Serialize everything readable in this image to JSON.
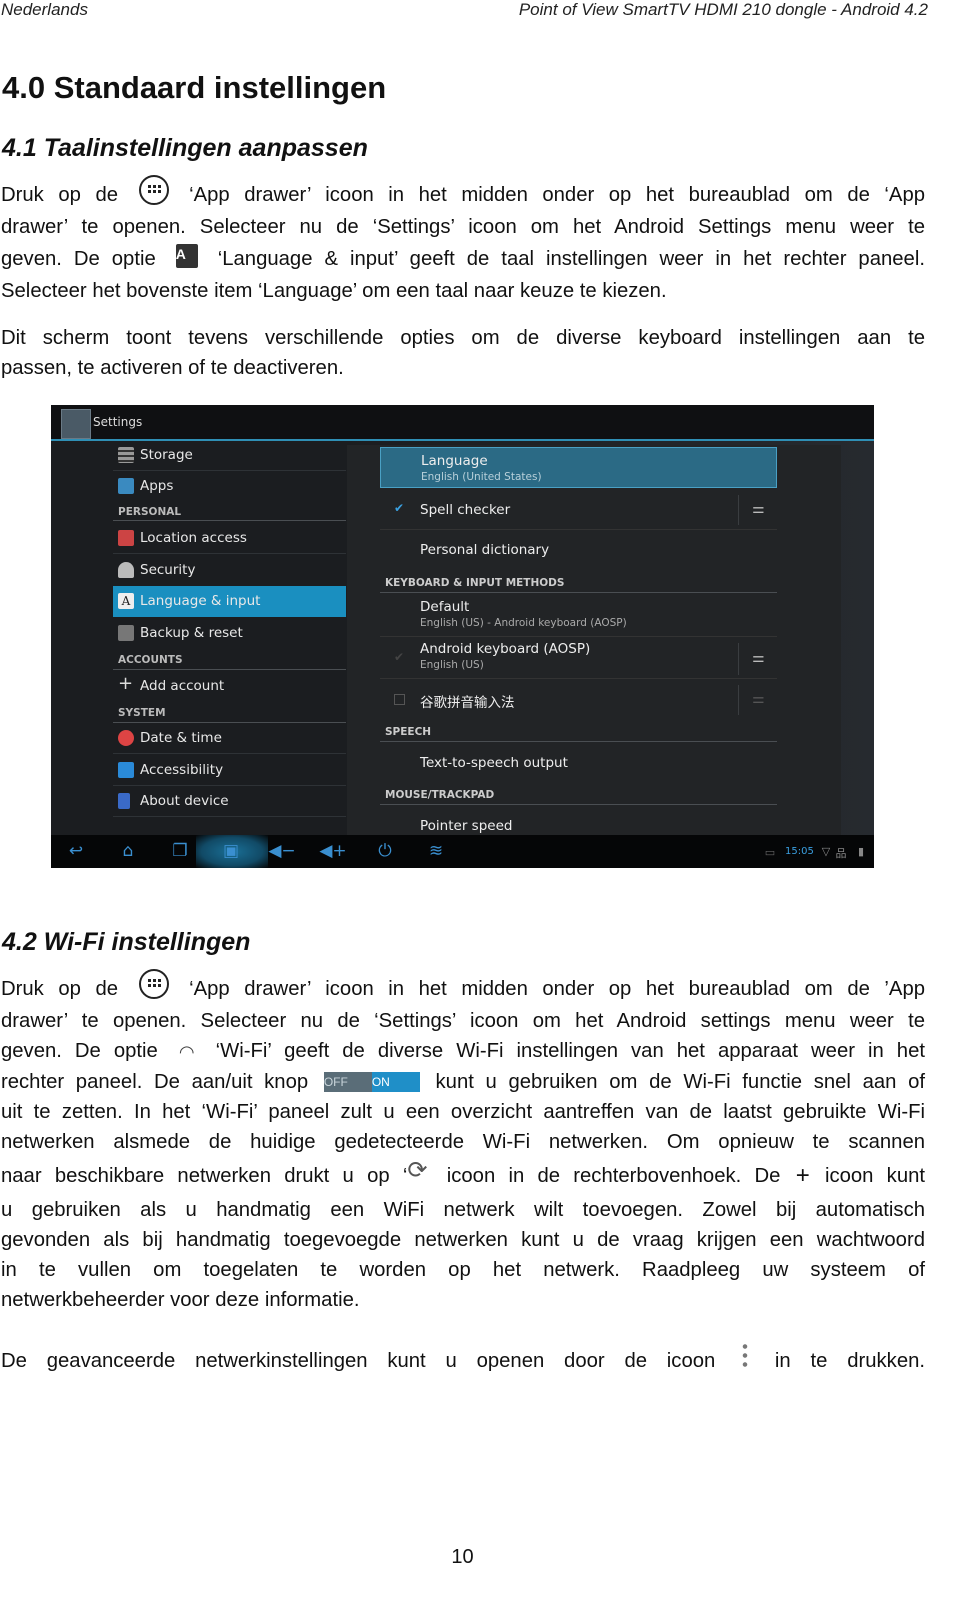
{
  "header": {
    "left": "Nederlands",
    "right": "Point of View SmartTV HDMI 210 dongle - Android 4.2"
  },
  "h1": "4.0 Standaard instellingen",
  "s41": {
    "title": "4.1 Taalinstellingen aanpassen",
    "p1": [
      [
        "Druk op de",
        "‘App drawer’ icoon in het midden onder op het bureaublad om de ‘App"
      ],
      [
        "drawer’ te openen. Selecteer nu de ‘Settings’ icoon om het Android Settings menu weer te"
      ],
      [
        "geven. De optie",
        "‘Language & input’ geeft de taal instellingen weer in het rechter paneel."
      ],
      [
        "Selecteer het bovenste item ‘Language’ om een taal naar keuze te kiezen."
      ]
    ],
    "p2": [
      [
        "Dit scherm toont tevens verschillende opties om de diverse keyboard instellingen aan te"
      ],
      [
        "passen, te activeren of te deactiveren."
      ]
    ],
    "lang_icon_letter": "A"
  },
  "screenshot": {
    "title": "Settings",
    "left": {
      "storage": "Storage",
      "apps": "Apps",
      "personal": "PERSONAL",
      "location": "Location access",
      "security": "Security",
      "language_input": "Language & input",
      "backup": "Backup & reset",
      "accounts": "ACCOUNTS",
      "add_account": "Add account",
      "system": "SYSTEM",
      "date_time": "Date & time",
      "accessibility": "Accessibility",
      "about": "About device"
    },
    "right": {
      "language": "Language",
      "language_sub": "English (United States)",
      "spell": "Spell checker",
      "spell_checked": true,
      "dictionary": "Personal dictionary",
      "kb_header": "KEYBOARD & INPUT METHODS",
      "default": "Default",
      "default_sub": "English (US) - Android keyboard (AOSP)",
      "aosp": "Android keyboard (AOSP)",
      "aosp_sub": "English (US)",
      "aosp_checked": true,
      "pinyin": "谷歌拼音输入法",
      "pinyin_checked": false,
      "speech_header": "SPEECH",
      "tts": "Text-to-speech output",
      "mouse_header": "MOUSE/TRACKPAD",
      "pointer": "Pointer speed"
    },
    "clock": "15:05",
    "accent": "#1a8fc0"
  },
  "s42": {
    "title": "4.2 Wi-Fi instellingen",
    "p1": [
      [
        "Druk op de",
        "‘App drawer’ icoon in het midden onder op het bureaublad om de ’App"
      ],
      [
        "drawer’ te openen. Selecteer nu de ‘Settings’ icoon om het Android settings menu weer te"
      ],
      [
        "geven. De optie",
        "‘Wi-Fi’ geeft de diverse Wi-Fi instellingen van het apparaat weer in het"
      ],
      [
        "rechter paneel. De aan/uit knop",
        "kunt u gebruiken om de Wi-Fi functie snel aan of"
      ],
      [
        "uit te zetten. In het ‘Wi-Fi’ paneel zult u een overzicht aantreffen van de laatst gebruikte Wi-Fi"
      ],
      [
        "netwerken alsmede de huidige gedetecteerde Wi-Fi netwerken. Om opnieuw te scannen"
      ],
      [
        "naar beschikbare netwerken drukt u op ‘",
        "icoon in de rechterbovenhoek. De",
        "icoon kunt"
      ],
      [
        "u gebruiken als u handmatig een WiFi netwerk wilt toevoegen. Zowel bij automatisch"
      ],
      [
        "gevonden als bij handmatig toegevoegde netwerken kunt u de vraag krijgen een wachtwoord"
      ],
      [
        "in te vullen om toegelaten te worden op het netwerk. Raadpleeg uw systeem of"
      ],
      [
        "netwerkbeheerder voor deze informatie."
      ]
    ],
    "p2": [
      [
        "De geavanceerde netwerkinstellingen kunt u openen door de icoon",
        "in te drukken."
      ]
    ],
    "toggle": {
      "off": "OFF",
      "on": "ON",
      "state": "on"
    }
  },
  "page_number": "10"
}
